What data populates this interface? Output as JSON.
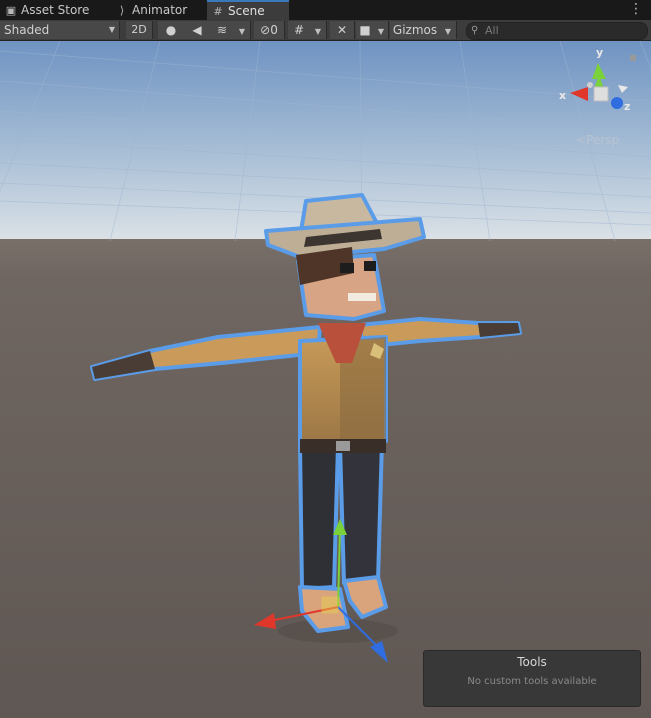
{
  "tabs": [
    {
      "label": "Asset Store",
      "icon": "shopping-bag-icon",
      "active": false
    },
    {
      "label": "Animator",
      "icon": "animator-icon",
      "active": false
    },
    {
      "label": "Scene",
      "icon": "grid-icon",
      "active": true
    }
  ],
  "toolbar": {
    "draw_mode": "Shaded",
    "toggle_2d": "2D",
    "hidden_count": "0",
    "gizmos": "Gizmos",
    "search_placeholder": "All"
  },
  "orientation_gizmo": {
    "y_label": "y",
    "x_label": "x",
    "z_label": "z",
    "projection": "Persp"
  },
  "tools_overlay": {
    "title": "Tools",
    "message": "No custom tools available"
  },
  "colors": {
    "axis_x": "#e0372a",
    "axis_y": "#7ad13a",
    "axis_z": "#2f6de0",
    "selection_outline": "#5b9ce8"
  }
}
